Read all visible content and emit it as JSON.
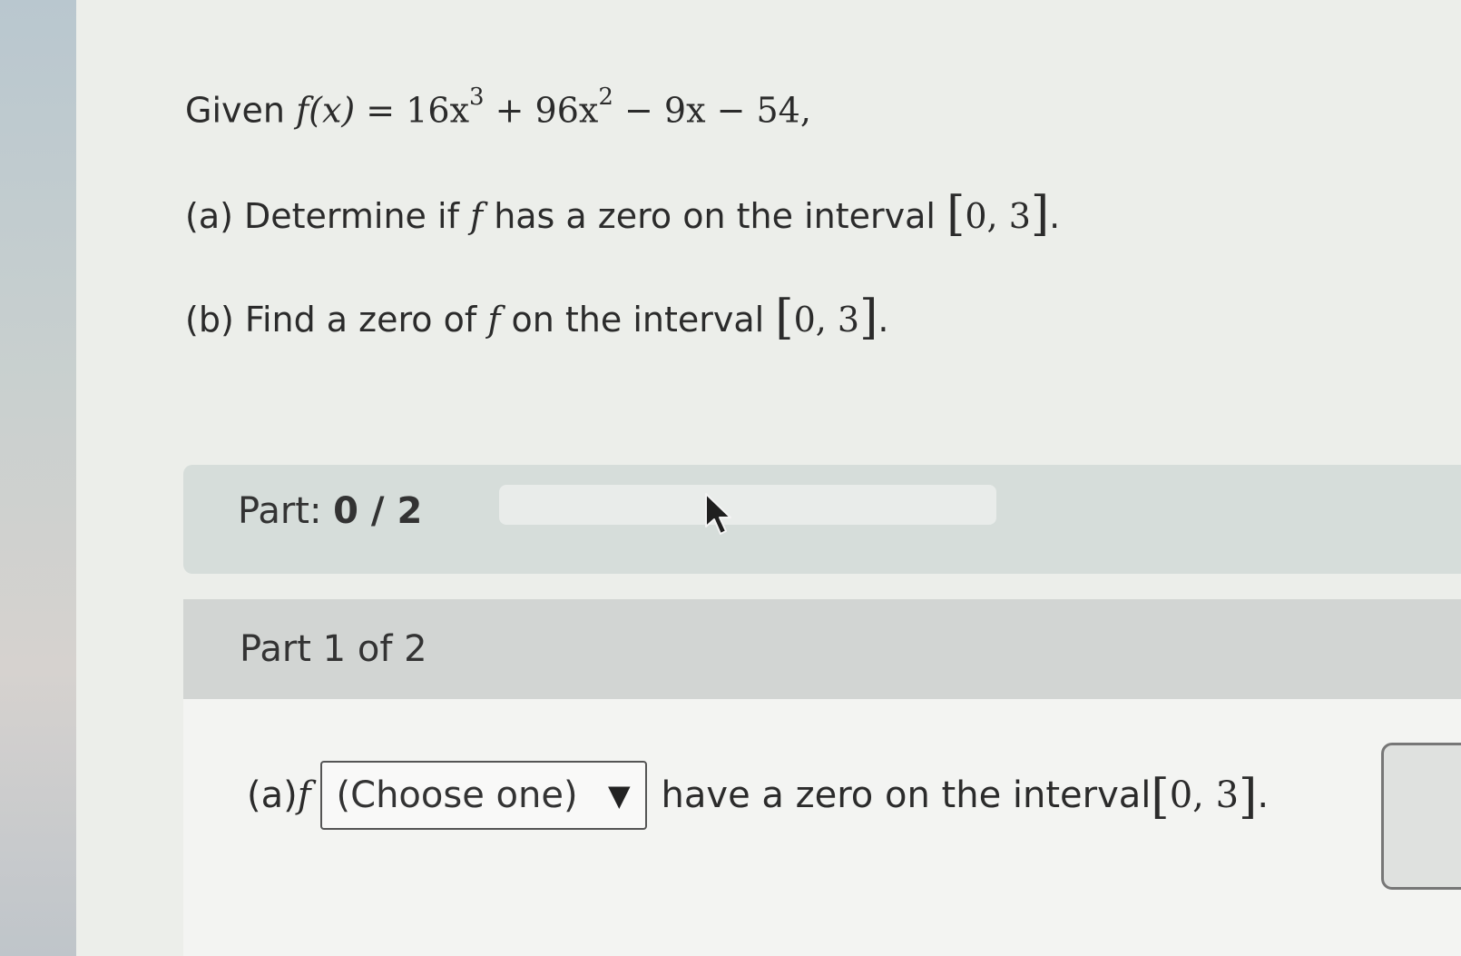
{
  "question": {
    "given_label": "Given",
    "function_lhs": "f(x) = ",
    "term1": "16x",
    "term1_exp": "3",
    "term2": " + 96x",
    "term2_exp": "2",
    "term3": " − 9x − 54,",
    "part_a_prefix": "(a) Determine if ",
    "part_a_f": "f",
    "part_a_middle": " has a zero on the interval ",
    "part_b_prefix": "(b) Find a zero of ",
    "part_b_f": "f",
    "part_b_middle": " on the interval ",
    "interval_open": "[",
    "interval_values": "0, 3",
    "interval_close": "]",
    "period": "."
  },
  "progress": {
    "label": "Part: ",
    "score": "0 / 2",
    "fraction_complete": 0
  },
  "part_header": {
    "label": "Part 1 of 2"
  },
  "answer": {
    "prefix": "(a) ",
    "f": "f",
    "select_value": "(Choose one)",
    "select_arrow": "▼",
    "suffix": "have a zero on the interval ",
    "interval_open": "[",
    "interval_values": "0, 3",
    "interval_close": "]",
    "period": "."
  },
  "icons": {
    "cursor": "mouse-pointer-icon",
    "dropdown": "triangle-down-icon"
  },
  "colors": {
    "progress_bar": "#d6ddda",
    "part_header": "#d2d5d3",
    "answer_panel": "#f3f4f2"
  }
}
